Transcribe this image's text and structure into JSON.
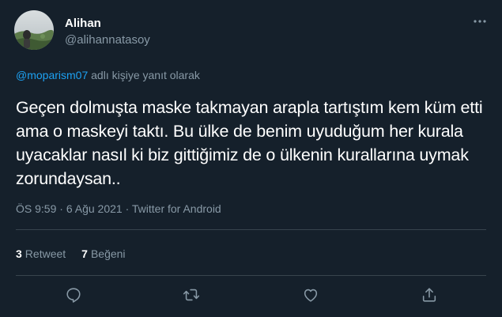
{
  "author": {
    "display_name": "Alihan",
    "handle": "@alihannatasoy",
    "avatar_icon": "profile-photo"
  },
  "more_icon": "ellipsis-icon",
  "reply_context": {
    "mention": "@moparism07",
    "suffix": " adlı kişiye yanıt olarak"
  },
  "tweet": {
    "text": "Geçen dolmuşta maske takmayan arapla tartıştım kem küm etti ama o maskeyi taktı. Bu ülke de benim uyuduğum her kurala uyacaklar nasıl ki biz gittiğimiz de o ülkenin kurallarına uymak zorundaysan.."
  },
  "meta": {
    "time": "ÖS 9:59",
    "separator": " · ",
    "date": "6 Ağu 2021",
    "source": "Twitter for Android"
  },
  "stats": {
    "retweets_count": "3",
    "retweets_label": "Retweet",
    "likes_count": "7",
    "likes_label": "Beğeni"
  },
  "actions": [
    "reply-icon",
    "retweet-icon",
    "like-icon",
    "share-icon"
  ],
  "colors": {
    "background": "#15202b",
    "text": "#ffffff",
    "secondary": "#8899a6",
    "accent": "#1da1f2",
    "divider": "#38444d"
  }
}
